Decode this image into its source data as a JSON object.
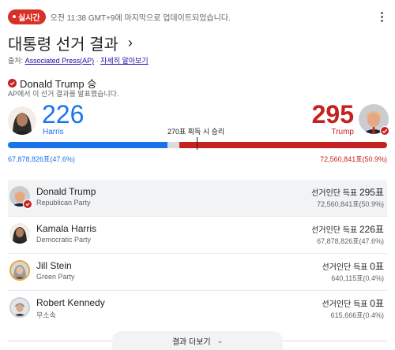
{
  "header": {
    "live_label": "실시간",
    "updated_text": "오전 11:38 GMT+9에 마지막으로 업데이트되었습니다."
  },
  "title": "대통령 선거 결과",
  "source": {
    "prefix": "출처:",
    "source_link": "Associated Press(AP)",
    "separator": "·",
    "more_link": "자세히 알아보기"
  },
  "winner": {
    "text": "Donald Trump 승",
    "called_text": "AP에서 이 선거 결과를 발표했습니다."
  },
  "summary": {
    "harris_votes": "226",
    "harris_name": "Harris",
    "trump_votes": "295",
    "trump_name": "Trump",
    "threshold_text": "270표 획득 시 승리",
    "harris_popular": "67,878,826표(47.6%)",
    "trump_popular": "72,560,841표(50.9%)",
    "total_electoral": 538,
    "colors": {
      "harris": "#1a73e8",
      "trump": "#c5221f",
      "uncalled": "#dadce0"
    }
  },
  "candidates": [
    {
      "name": "Donald Trump",
      "party": "Republican Party",
      "ev_label": "선거인단 득표",
      "ev": "295표",
      "pv": "72,560,841표(50.9%)",
      "winner": true
    },
    {
      "name": "Kamala Harris",
      "party": "Democratic Party",
      "ev_label": "선거인단 득표",
      "ev": "226표",
      "pv": "67,878,826표(47.6%)",
      "winner": false
    },
    {
      "name": "Jill Stein",
      "party": "Green Party",
      "ev_label": "선거인단 득표",
      "ev": "0표",
      "pv": "640,115표(0.4%)",
      "winner": false
    },
    {
      "name": "Robert Kennedy",
      "party": "무소속",
      "ev_label": "선거인단 득표",
      "ev": "0표",
      "pv": "615,666표(0.4%)",
      "winner": false
    }
  ],
  "more_results_label": "결과 더보기"
}
